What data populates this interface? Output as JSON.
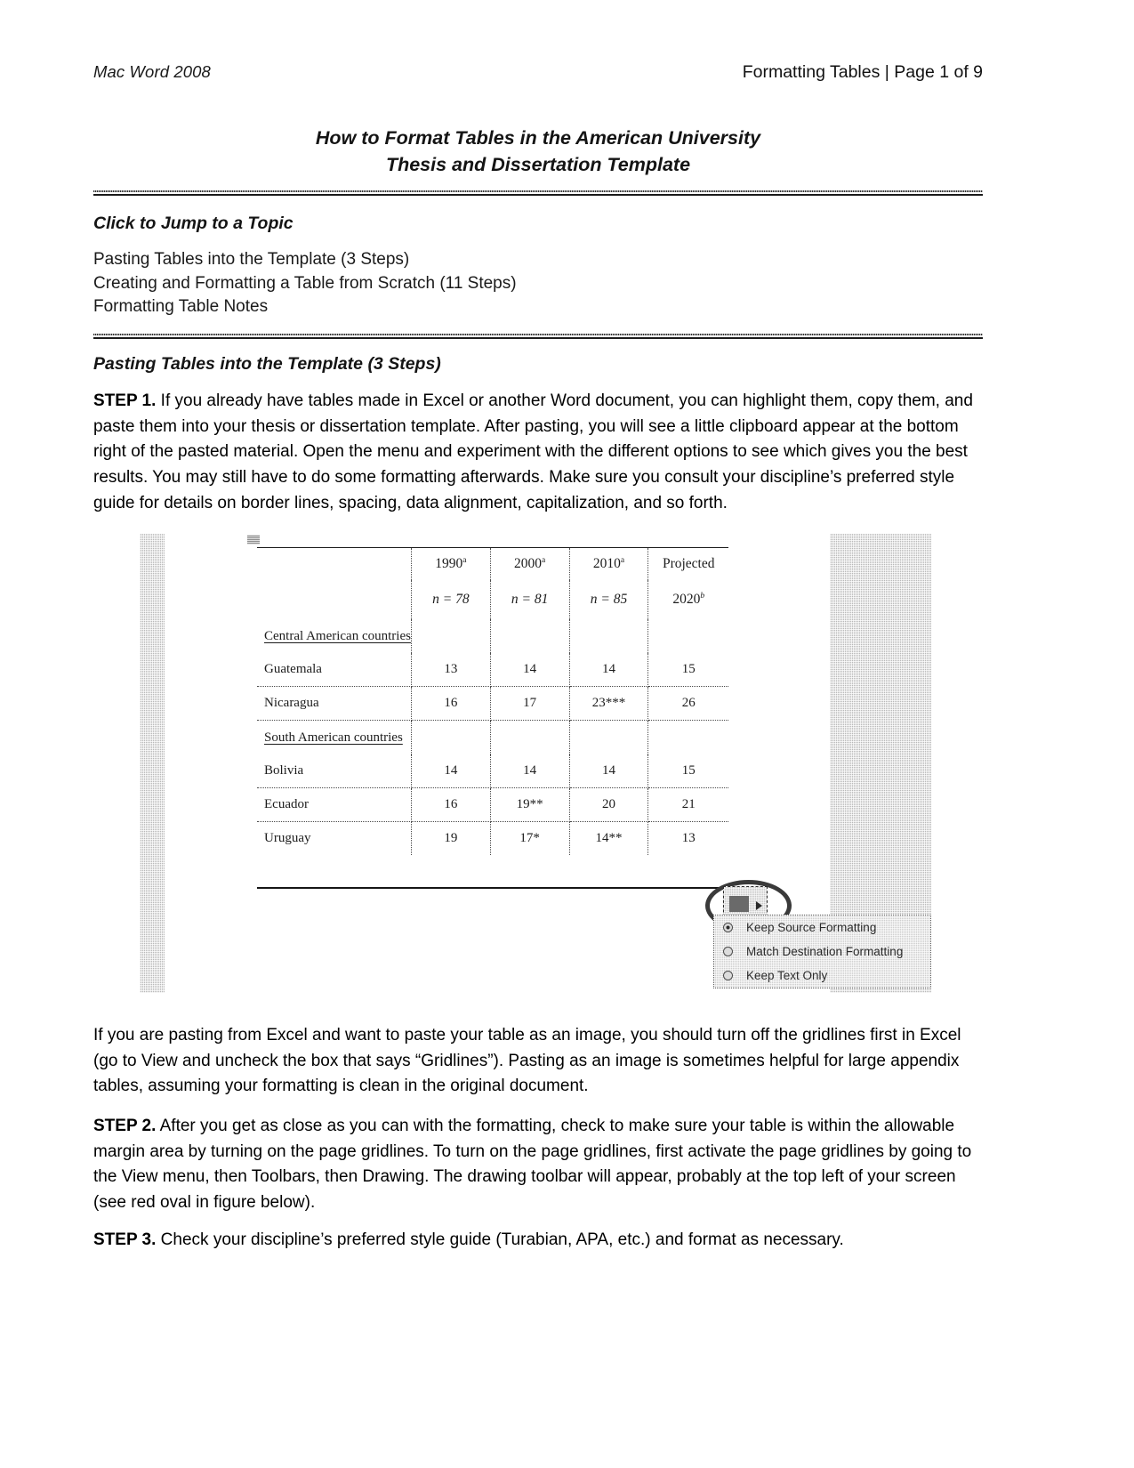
{
  "running_head": {
    "left": "Mac Word 2008",
    "right": "Formatting Tables | Page 1 of 9"
  },
  "title": {
    "line1": "How to Format Tables in the American University",
    "line2": "Thesis and Dissertation Template"
  },
  "toc": {
    "heading": "Click to Jump to a Topic",
    "items": [
      "Pasting Tables into the Template (3 Steps)",
      "Creating and Formatting a Table from Scratch (11 Steps)",
      "Formatting Table Notes"
    ]
  },
  "section": {
    "heading": "Pasting Tables into the Template (3 Steps)"
  },
  "paragraphs": {
    "step1_label": "STEP 1.",
    "step1_text": " If you already have tables made in Excel or another Word document, you can highlight them, copy them, and paste them into your thesis or dissertation template. After pasting, you will see a little clipboard appear at the bottom right of the pasted material. Open the menu and experiment with the different options to see which gives you the best results. You may still have to do some formatting afterwards. Make sure you consult your discipline’s preferred style guide for details on border lines, spacing, data alignment, capitalization, and so forth.",
    "excel_note": "If you are pasting from Excel and want to paste your table as an image, you should turn off the gridlines first in Excel (go to View and uncheck the box that says “Gridlines”). Pasting as an image is sometimes helpful for large appendix tables, assuming your formatting is clean in the original document.",
    "step2_label": "STEP 2.",
    "step2_text": " After you get as close as you can with the formatting, check to make sure your table is within the allowable margin area by turning on the page gridlines. To turn on the page gridlines, first activate the page gridlines by going to the View menu, then Toolbars, then Drawing. The drawing toolbar will appear, probably at the top left of your screen (see red oval in figure below).",
    "step3_label": "STEP 3.",
    "step3_text": " Check your discipline’s preferred style guide (Turabian, APA, etc.) and format as necessary."
  },
  "figure": {
    "embedded_table": {
      "column_headers_line1": [
        "",
        "1990",
        "2000",
        "2010",
        "Projected"
      ],
      "column_headers_sup": [
        "",
        "a",
        "a",
        "a",
        ""
      ],
      "column_headers_line2": [
        "",
        "n = 78",
        "n = 81",
        "n = 85",
        "2020"
      ],
      "column_headers_line2_sup": [
        "",
        "",
        "",
        "",
        "b"
      ],
      "rows": [
        {
          "type": "group",
          "label": "Central American countries"
        },
        {
          "type": "data",
          "label": "Guatemala",
          "values": [
            "13",
            "14",
            "14",
            "15"
          ]
        },
        {
          "type": "data",
          "label": "Nicaragua",
          "values": [
            "16",
            "17",
            "23***",
            "26"
          ]
        },
        {
          "type": "group",
          "label": "South American countries"
        },
        {
          "type": "data",
          "label": "Bolivia",
          "values": [
            "14",
            "14",
            "14",
            "15"
          ]
        },
        {
          "type": "data",
          "label": "Ecuador",
          "values": [
            "16",
            "19**",
            "20",
            "21"
          ]
        },
        {
          "type": "data",
          "label": "Uruguay",
          "values": [
            "19",
            "17*",
            "14**",
            "13"
          ]
        }
      ]
    },
    "paste_menu": {
      "items": [
        {
          "label": "Keep Source Formatting",
          "selected": true
        },
        {
          "label": "Match Destination Formatting",
          "selected": false
        },
        {
          "label": "Keep Text Only",
          "selected": false
        }
      ]
    }
  },
  "colors": {
    "text": "#000000",
    "rule": "#1a1a1a",
    "gridline_band": "#b9b9b9"
  }
}
